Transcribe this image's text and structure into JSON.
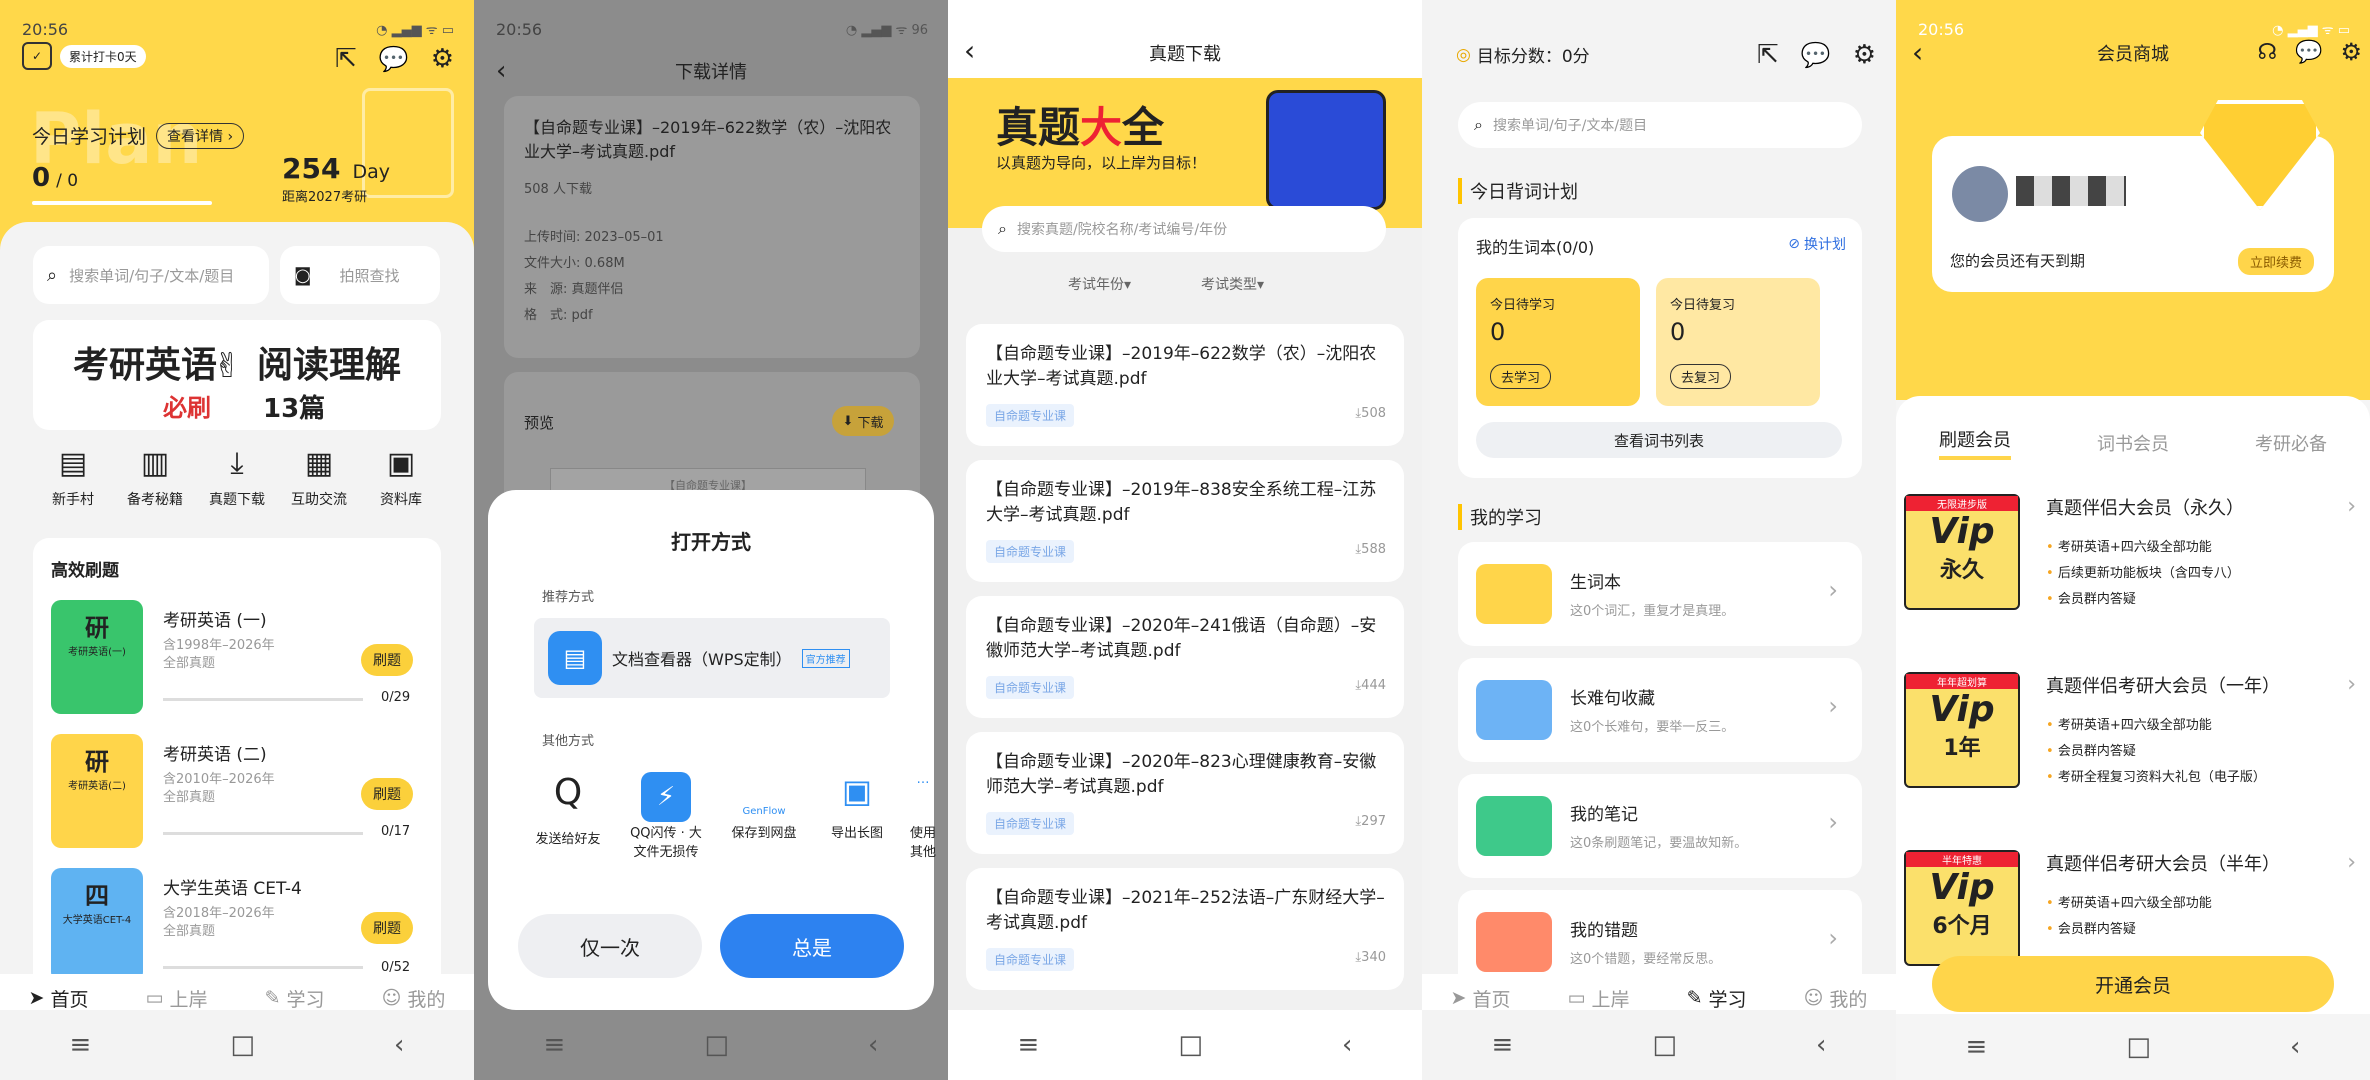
{
  "s1": {
    "time": "20:56",
    "checkin_badge": "累计打卡0天",
    "plan_title": "今日学习计划",
    "plan_detail_btn": "查看详情",
    "plan_progress": "0",
    "plan_progress_total": "/ 0",
    "plan_bg_word": "Plan",
    "days_count": "254",
    "days_unit": "Day",
    "days_label": "距离2027考研",
    "search_placeholder": "搜索单词/句子/文本/题目",
    "photo_search": "拍照查找",
    "banner_part1": "考研英语",
    "banner_part2": "阅读理解",
    "banner_must": "必刷",
    "banner_count": "13篇",
    "quick": [
      "新手村",
      "备考秘籍",
      "真题下载",
      "互助交流",
      "资料库"
    ],
    "section_title": "高效刷题",
    "courses": [
      {
        "thumb_title": "研",
        "thumb_sub": "考研英语(一)",
        "title": "考研英语 (一)",
        "years": "含1998年–2026年",
        "scope": "全部真题",
        "btn": "刷题",
        "progress": "0/29"
      },
      {
        "thumb_title": "研",
        "thumb_sub": "考研英语(二)",
        "title": "考研英语 (二)",
        "years": "含2010年–2026年",
        "scope": "全部真题",
        "btn": "刷题",
        "progress": "0/17"
      },
      {
        "thumb_title": "四",
        "thumb_sub": "大学英语CET-4",
        "title": "大学生英语 CET-4",
        "years": "含2018年–2026年",
        "scope": "全部真题",
        "btn": "刷题",
        "progress": "0/52"
      }
    ],
    "tabs": [
      "首页",
      "上岸",
      "学习",
      "我的"
    ]
  },
  "s2": {
    "time": "20:56",
    "battery": "96",
    "title": "下载详情",
    "file_name": "【自命题专业课】–2019年–622数学（农）–沈阳农业大学–考试真题.pdf",
    "download_count": "508 人下载",
    "meta": [
      {
        "k": "上传时间:",
        "v": "2023–05–01"
      },
      {
        "k": "文件大小:",
        "v": "0.68M"
      },
      {
        "k": "来　源:",
        "v": "真题伴侣"
      },
      {
        "k": "格　式:",
        "v": "pdf"
      }
    ],
    "preview_label": "预览",
    "preview_download": "下载",
    "preview_doc_text": "【自命题专业课】",
    "sheet_title": "打开方式",
    "recommended_label": "推荐方式",
    "recommended_app": "文档查看器（WPS定制）",
    "recommended_badge": "官方推荐",
    "other_label": "其他方式",
    "apps": [
      {
        "name": "发送给好友",
        "glyph": "Q"
      },
      {
        "name": "QQ闪传 · 大文件无损传",
        "glyph": "⚡"
      },
      {
        "name": "保存到网盘",
        "glyph": "GenFlow"
      },
      {
        "name": "导出长图",
        "glyph": "▣"
      },
      {
        "name": "使用其他",
        "glyph": "…"
      }
    ],
    "btn_once": "仅一次",
    "btn_always": "总是"
  },
  "s3": {
    "title": "真题下载",
    "hero_a": "真题",
    "hero_b": "大",
    "hero_c": "全",
    "hero_sub": "以真题为导向，以上岸为目标！",
    "search_placeholder": "搜索真题/院校名称/考试编号/年份",
    "filter_year": "考试年份",
    "filter_type": "考试类型",
    "items": [
      {
        "title": "【自命题专业课】–2019年–622数学（农）–沈阳农业大学–考试真题.pdf",
        "tag": "自命题专业课",
        "count": "508"
      },
      {
        "title": "【自命题专业课】–2019年–838安全系统工程–江苏大学–考试真题.pdf",
        "tag": "自命题专业课",
        "count": "588"
      },
      {
        "title": "【自命题专业课】–2020年–241俄语（自命题）–安徽师范大学–考试真题.pdf",
        "tag": "自命题专业课",
        "count": "444"
      },
      {
        "title": "【自命题专业课】–2020年–823心理健康教育–安徽师范大学–考试真题.pdf",
        "tag": "自命题专业课",
        "count": "297"
      },
      {
        "title": "【自命题专业课】–2021年–252法语–广东财经大学–考试真题.pdf",
        "tag": "自命题专业课",
        "count": "340"
      }
    ]
  },
  "s4": {
    "target": "目标分数：0分",
    "search_placeholder": "搜索单词/句子/文本/题目",
    "plan_title": "今日背词计划",
    "wordbook": "我的生词本(0/0)",
    "change_plan": "换计划",
    "learn_title": "今日待学习",
    "learn_count": "0",
    "learn_btn": "去学习",
    "review_title": "今日待复习",
    "review_count": "0",
    "review_btn": "去复习",
    "view_list": "查看词书列表",
    "my_title": "我的学习",
    "items": [
      {
        "title": "生词本",
        "desc": "这0个词汇，重复才是真理。",
        "color": "#ffd54a"
      },
      {
        "title": "长难句收藏",
        "desc": "这0个长难句，要举一反三。",
        "color": "#6db3f5"
      },
      {
        "title": "我的笔记",
        "desc": "这0条刷题笔记，要温故知新。",
        "color": "#3ec98a"
      },
      {
        "title": "我的错题",
        "desc": "这0个错题，要经常反思。",
        "color": "#ff8a6a"
      }
    ],
    "tabs": [
      "首页",
      "上岸",
      "学习",
      "我的"
    ]
  },
  "s5": {
    "time": "20:56",
    "title": "会员商城",
    "member_status": "您的会员还有天到期",
    "renew_btn": "立即续费",
    "tabs": [
      "刷题会员",
      "词书会员",
      "考研必备"
    ],
    "items": [
      {
        "title": "真题伴侣大会员（永久）",
        "thumb_badge": "无限进步版",
        "thumb_big": "Vip",
        "thumb_small": "永久",
        "features": [
          "考研英语+四六级全部功能",
          "后续更新功能板块（含四专八）",
          "会员群内答疑"
        ]
      },
      {
        "title": "真题伴侣考研大会员（一年）",
        "thumb_badge": "年年超划算",
        "thumb_big": "Vip",
        "thumb_small": "1年",
        "features": [
          "考研英语+四六级全部功能",
          "会员群内答疑",
          "考研全程复习资料大礼包（电子版）"
        ]
      },
      {
        "title": "真题伴侣考研大会员（半年）",
        "thumb_badge": "半年特惠",
        "thumb_big": "Vip",
        "thumb_small": "6个月",
        "features": [
          "考研英语+四六级全部功能",
          "会员群内答疑"
        ]
      }
    ],
    "open_btn": "开通会员"
  }
}
